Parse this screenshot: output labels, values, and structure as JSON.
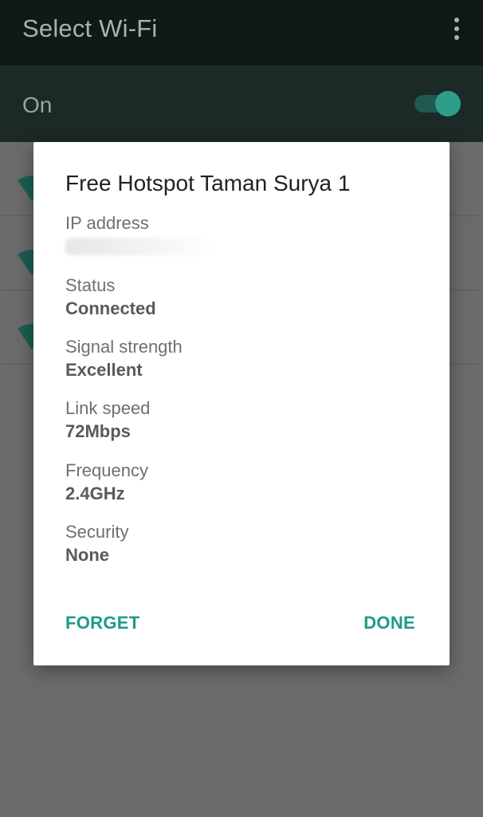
{
  "appbar": {
    "title": "Select Wi-Fi"
  },
  "wifi_toggle": {
    "label": "On",
    "state": "on"
  },
  "networks": [
    {
      "icon": "wifi-signal-icon"
    },
    {
      "icon": "wifi-signal-icon"
    },
    {
      "icon": "wifi-signal-icon"
    }
  ],
  "dialog": {
    "title": "Free Hotspot Taman Surya 1",
    "fields": [
      {
        "label": "IP address",
        "value": ""
      },
      {
        "label": "Status",
        "value": "Connected"
      },
      {
        "label": "Signal strength",
        "value": "Excellent"
      },
      {
        "label": "Link speed",
        "value": "72Mbps"
      },
      {
        "label": "Frequency",
        "value": "2.4GHz"
      },
      {
        "label": "Security",
        "value": "None"
      }
    ],
    "forget_label": "FORGET",
    "done_label": "DONE"
  },
  "colors": {
    "accent": "#1e9b86",
    "appbar": "#0f1a18",
    "scrim": "#6b6b6b"
  }
}
